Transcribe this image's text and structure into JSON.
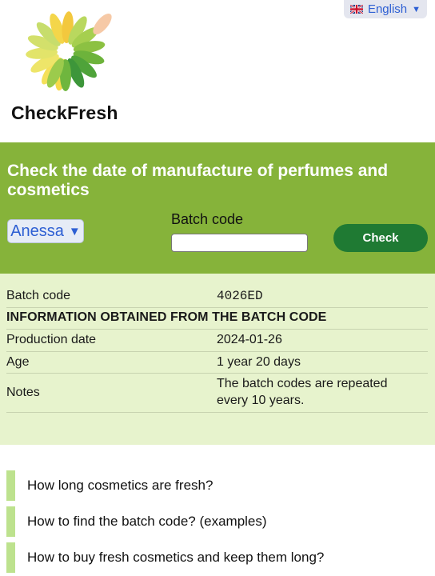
{
  "header": {
    "brand_name": "CheckFresh",
    "language": {
      "label": "English",
      "flag_icon": "uk-flag-icon"
    }
  },
  "search": {
    "title": "Check the date of manufacture of perfumes and cosmetics",
    "brand_selected": "Anessa",
    "batch_label": "Batch code",
    "batch_value": "",
    "batch_placeholder": "",
    "check_label": "Check"
  },
  "results": {
    "batch_code_label": "Batch code",
    "batch_code_value": "4026ED",
    "section_heading": "INFORMATION OBTAINED FROM THE BATCH CODE",
    "production_label": "Production date",
    "production_value": "2024-01-26",
    "age_label": "Age",
    "age_value": "1 year 20 days",
    "notes_label": "Notes",
    "notes_line1": "The batch codes are repeated",
    "notes_line2": "every 10 years."
  },
  "links": [
    {
      "label": "How long cosmetics are fresh?"
    },
    {
      "label": "How to find the batch code? (examples)"
    },
    {
      "label": "How to buy fresh cosmetics and keep them long?"
    }
  ],
  "colors": {
    "band": "#86b33a",
    "results_bg": "#e7f3cd",
    "check_button": "#1f7a33",
    "link_accent": "#bde28e",
    "link_blue": "#2d5fd3"
  }
}
